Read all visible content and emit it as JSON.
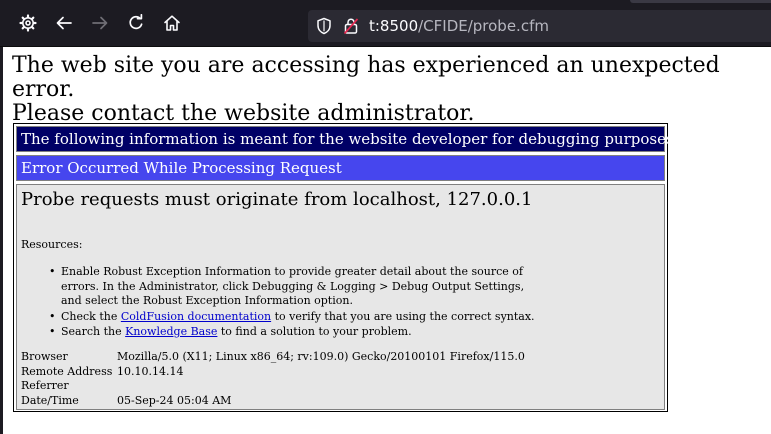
{
  "browser": {
    "url_host": "t:8500",
    "url_path": "/CFIDE/probe.cfm"
  },
  "page": {
    "headline_line1": "The web site you are accessing has experienced an unexpected error.",
    "headline_line2": "Please contact the website administrator.",
    "developer_bar": "The following information is meant for the website developer for debugging purposes.",
    "error_bar": "Error Occurred While Processing Request",
    "error_message": "Probe requests must originate from localhost, 127.0.0.1",
    "resources_label": "Resources:",
    "resources": {
      "item1_line1": "Enable Robust Exception Information to provide greater detail about the source of",
      "item1_line2": "errors. In the Administrator, click Debugging & Logging > Debug Output Settings,",
      "item1_line3": "and select the Robust Exception Information option.",
      "item2_pre": "Check the ",
      "item2_link": "ColdFusion documentation",
      "item2_post": " to verify that you are using the correct syntax.",
      "item3_pre": "Search the ",
      "item3_link": "Knowledge Base",
      "item3_post": " to find a solution to your problem."
    },
    "info": [
      {
        "key": "Browser",
        "value": "Mozilla/5.0 (X11; Linux x86_64; rv:109.0) Gecko/20100101 Firefox/115.0"
      },
      {
        "key": "Remote Address",
        "value": "10.10.14.14"
      },
      {
        "key": "Referrer",
        "value": ""
      },
      {
        "key": "Date/Time",
        "value": "05-Sep-24 05:04 AM"
      }
    ]
  }
}
